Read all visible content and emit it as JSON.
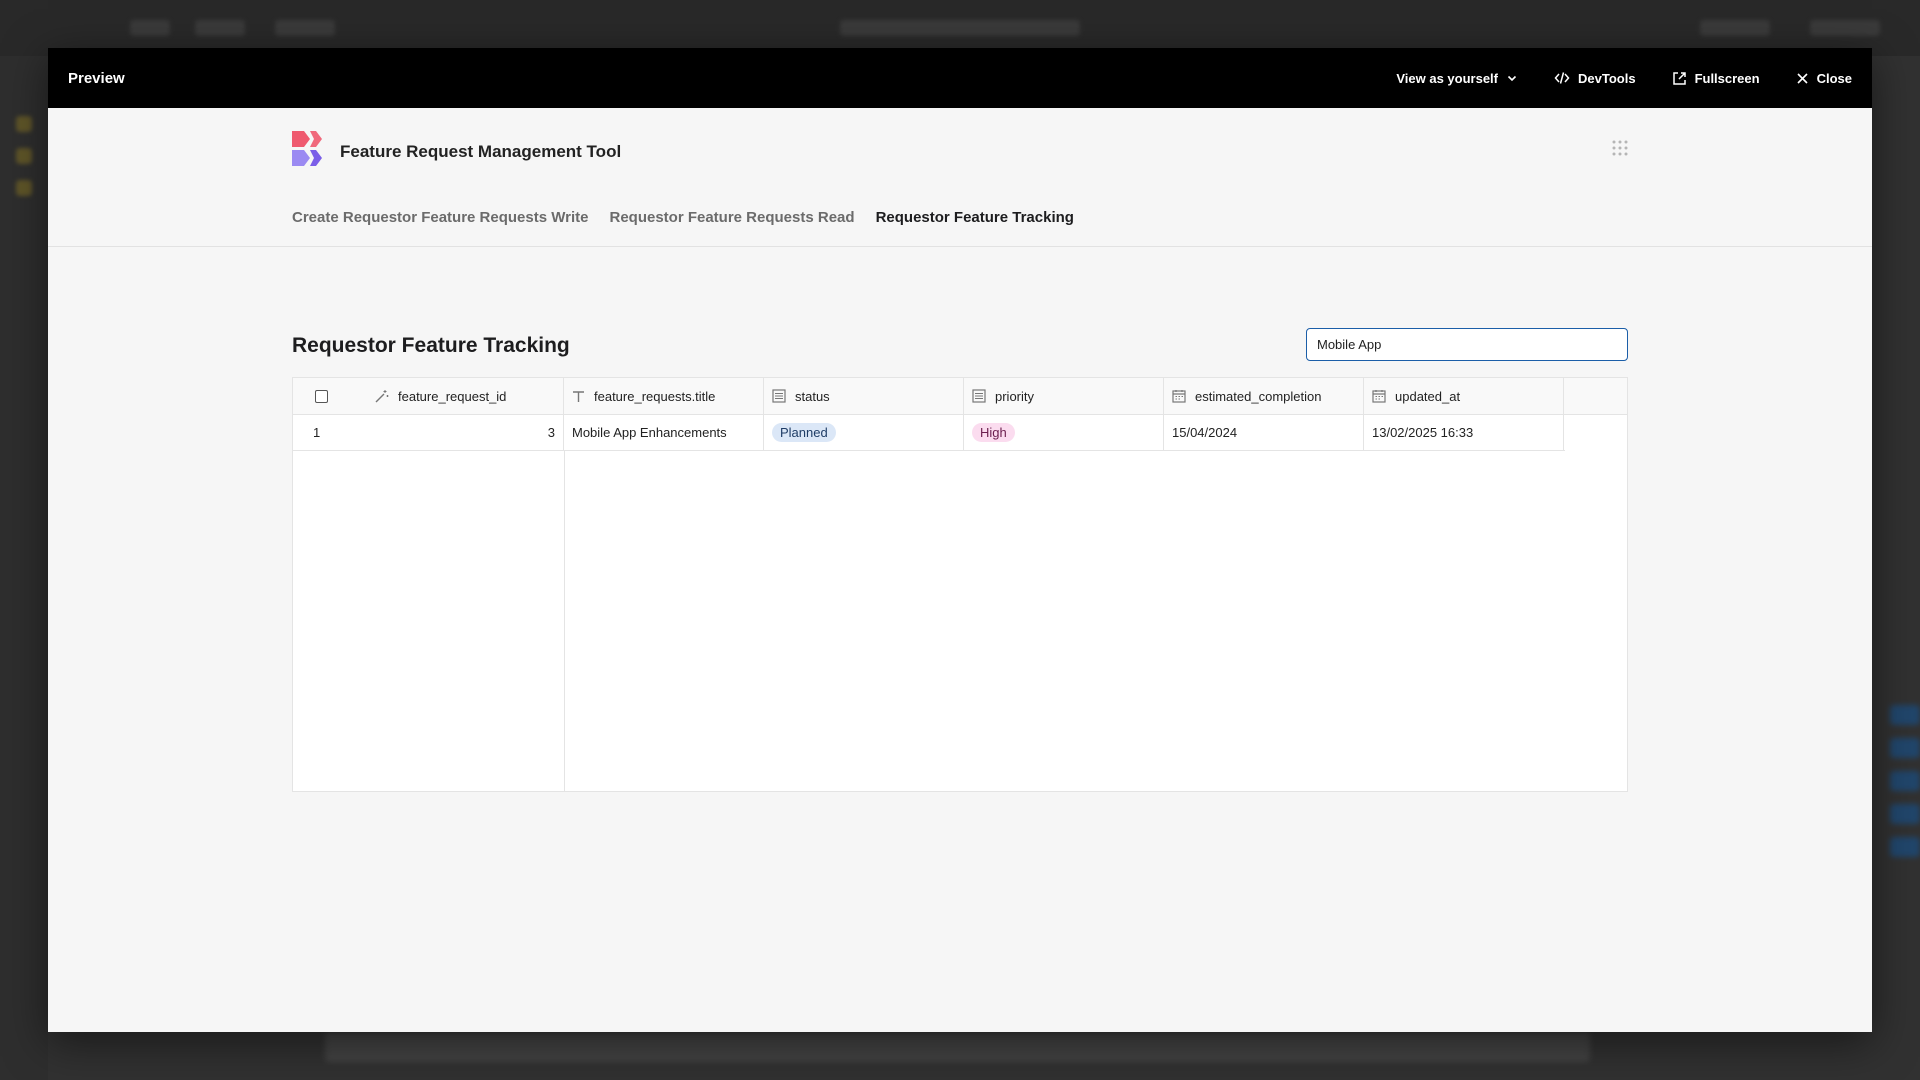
{
  "modal": {
    "title": "Preview",
    "view_as": "View as yourself",
    "devtools": "DevTools",
    "fullscreen": "Fullscreen",
    "close": "Close"
  },
  "app": {
    "title": "Feature Request Management Tool",
    "nav": [
      {
        "label": "Create Requestor Feature Requests Write",
        "active": false
      },
      {
        "label": "Requestor Feature Requests Read",
        "active": false
      },
      {
        "label": "Requestor Feature Tracking",
        "active": true
      }
    ]
  },
  "page": {
    "title": "Requestor Feature Tracking",
    "search_value": "Mobile App"
  },
  "table": {
    "columns": {
      "id": "feature_request_id",
      "title": "feature_requests.title",
      "status": "status",
      "priority": "priority",
      "est": "estimated_completion",
      "updated": "updated_at"
    },
    "rows": [
      {
        "index": "1",
        "id": "3",
        "title": "Mobile App Enhancements",
        "status": "Planned",
        "priority": "High",
        "est": "15/04/2024",
        "updated": "13/02/2025 16:33"
      }
    ]
  },
  "colors": {
    "accent": "#1b5ea8",
    "status_pill": "#dbe7f7",
    "priority_pill": "#fbdcef",
    "logo_red": "#ef5a6f",
    "logo_purple": "#8e7cf0"
  }
}
